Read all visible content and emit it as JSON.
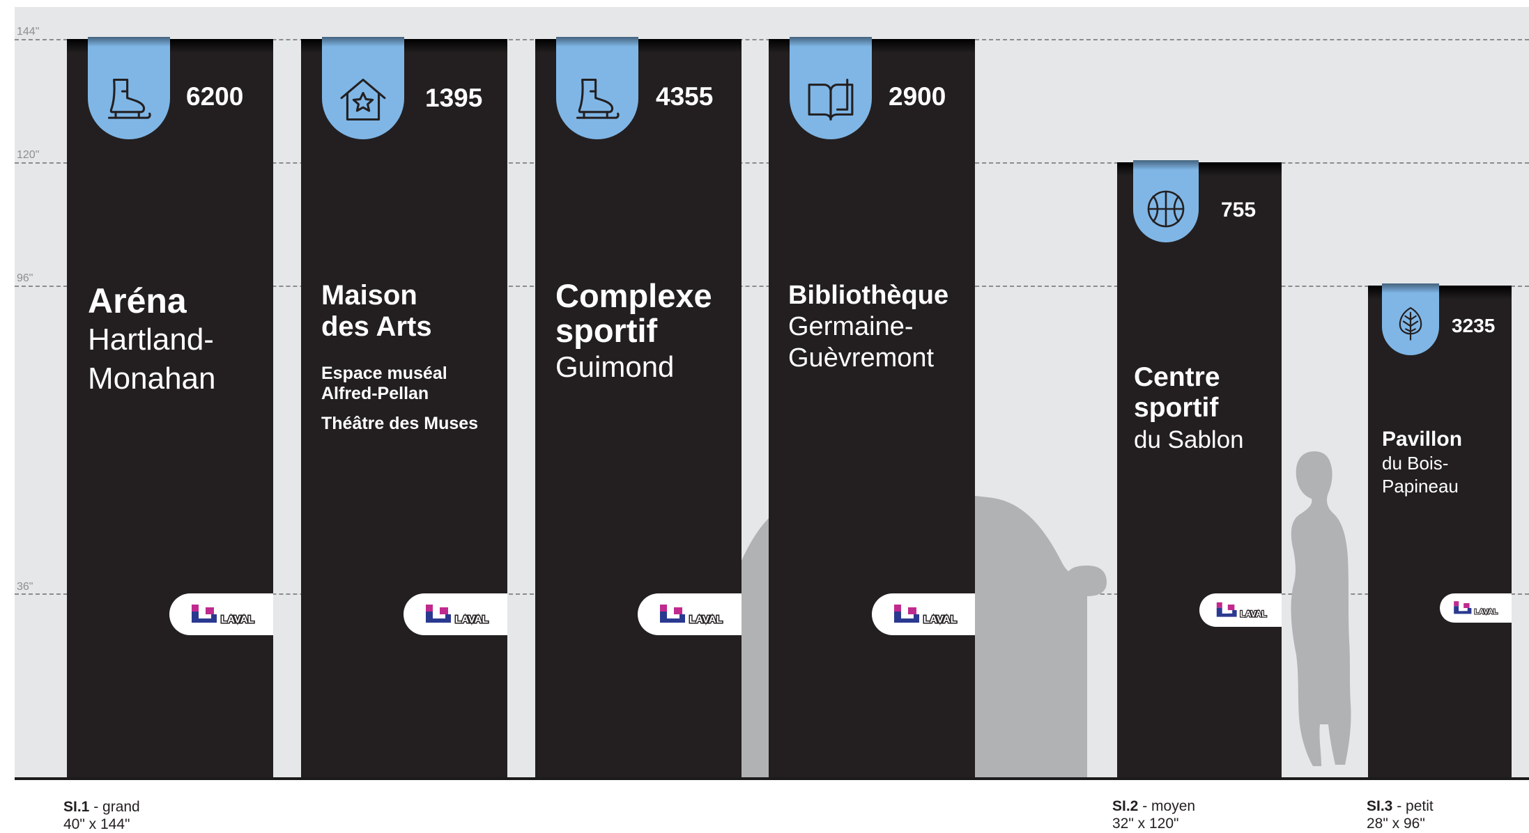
{
  "scale_labels": {
    "h144": "144\"",
    "h120": "120\"",
    "h96": "96\"",
    "h36": "36\""
  },
  "brand": {
    "logo_text": "LAVAL"
  },
  "colors": {
    "sign": "#231f20",
    "tab": "#7fb6e6",
    "background": "#e6e7e9",
    "dashed_line": "#8b8c8e",
    "logo_blue": "#2a3990",
    "logo_magenta": "#c02a8e"
  },
  "signs": [
    {
      "icon": "ice-skate-icon",
      "number": "6200",
      "title_bold": "Aréna",
      "title_regular": "Hartland-\nMonahan"
    },
    {
      "icon": "house-star-icon",
      "number": "1395",
      "title_bold": "Maison\ndes Arts",
      "sub1": "Espace muséal\nAlfred-Pellan",
      "sub2": "Théâtre des Muses"
    },
    {
      "icon": "ice-skate-icon",
      "number": "4355",
      "title_bold": "Complexe\nsportif",
      "title_regular": "Guimond"
    },
    {
      "icon": "open-book-icon",
      "number": "2900",
      "title_bold": "Bibliothèque",
      "title_regular": "Germaine-\nGuèvremont"
    },
    {
      "icon": "basketball-icon",
      "number": "755",
      "title_bold": "Centre\nsportif",
      "title_regular": "du Sablon"
    },
    {
      "icon": "tree-icon",
      "number": "3235",
      "title_bold": "Pavillon",
      "title_regular": "du Bois-\nPapineau"
    }
  ],
  "captions": [
    {
      "code": "SI.1",
      "size": "- grand",
      "dims": "40\" x 144\""
    },
    {
      "code": "SI.2",
      "size": "- moyen",
      "dims": "32\" x 120\""
    },
    {
      "code": "SI.3",
      "size": "- petit",
      "dims": "28\" x 96\""
    }
  ]
}
